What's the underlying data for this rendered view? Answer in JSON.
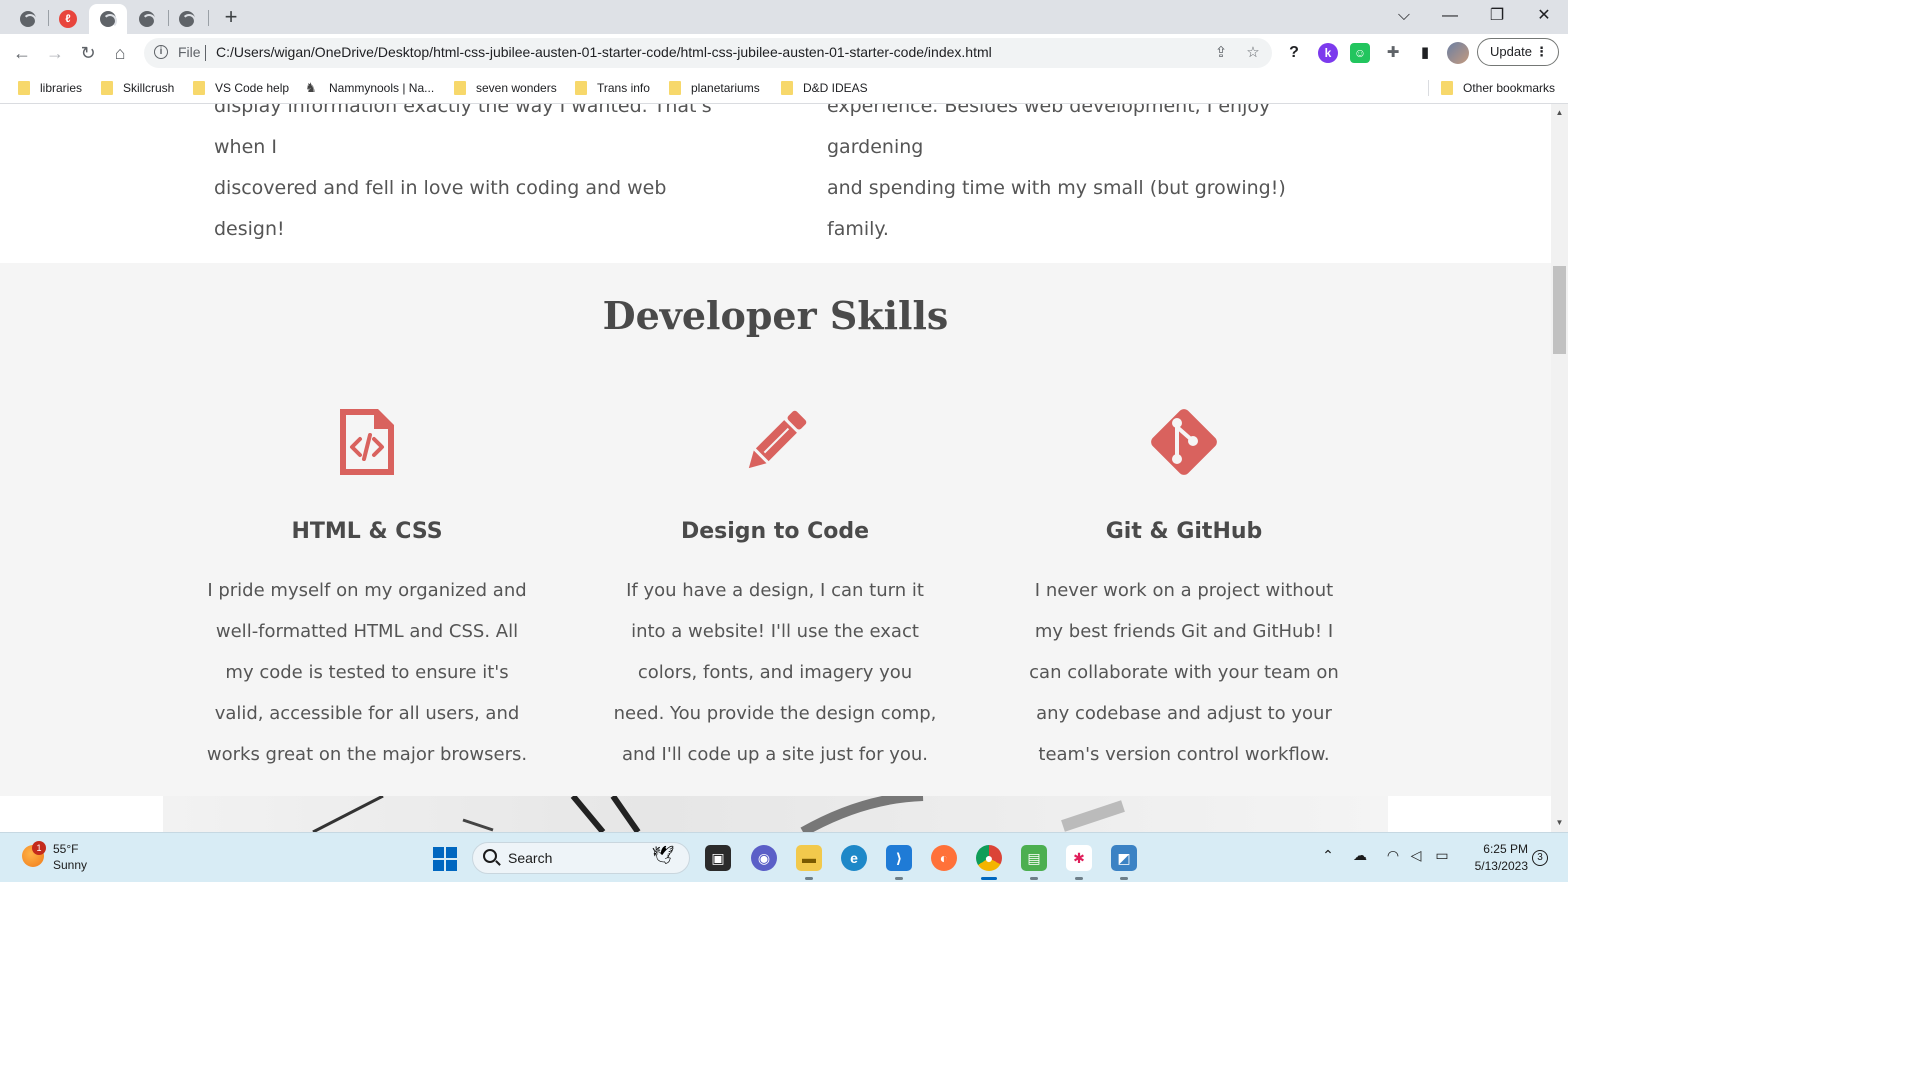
{
  "browser": {
    "url_scheme_label": "File",
    "url": "C:/Users/wigan/OneDrive/Desktop/html-css-jubilee-austen-01-starter-code/html-css-jubilee-austen-01-starter-code/index.html",
    "update_label": "Update",
    "bookmarks": [
      {
        "label": "libraries"
      },
      {
        "label": "Skillcrush"
      },
      {
        "label": "VS Code help"
      },
      {
        "label": "Nammynools | Na..."
      },
      {
        "label": "seven wonders"
      },
      {
        "label": "Trans info"
      },
      {
        "label": "planetariums"
      },
      {
        "label": "D&D IDEAS"
      }
    ],
    "other_bookmarks": "Other bookmarks"
  },
  "about": {
    "left_partial": "display information exactly the way I wanted. That's when I",
    "left_last": "discovered and fell in love with coding and web design!",
    "right_partial": "experience. Besides web development, I enjoy gardening",
    "right_last": "and spending time with my small (but growing!) family."
  },
  "skills": {
    "title": "Developer Skills",
    "accent_color": "#d9625e",
    "items": [
      {
        "icon": "file-code-icon",
        "name": "HTML & CSS",
        "lines": [
          "I pride myself on my organized and",
          "well-formatted HTML and CSS. All",
          "my code is tested to ensure it's",
          "valid, accessible for all users, and",
          "works great on the major browsers."
        ]
      },
      {
        "icon": "pencil-icon",
        "name": "Design to Code",
        "lines": [
          "If you have a design, I can turn it",
          "into a website! I'll use the exact",
          "colors, fonts, and imagery you",
          "need. You provide the design comp,",
          "and I'll code up a site just for you."
        ]
      },
      {
        "icon": "git-icon",
        "name": "Git & GitHub",
        "lines": [
          "I never work on a project without",
          "my best friends Git and GitHub! I",
          "can collaborate with your team on",
          "any codebase and adjust to your",
          "team's version control workflow."
        ]
      }
    ]
  },
  "taskbar": {
    "weather_temp": "55°F",
    "weather_condition": "Sunny",
    "weather_badge": "1",
    "search_label": "Search",
    "time": "6:25 PM",
    "date": "5/13/2023",
    "notification_count": "3"
  }
}
